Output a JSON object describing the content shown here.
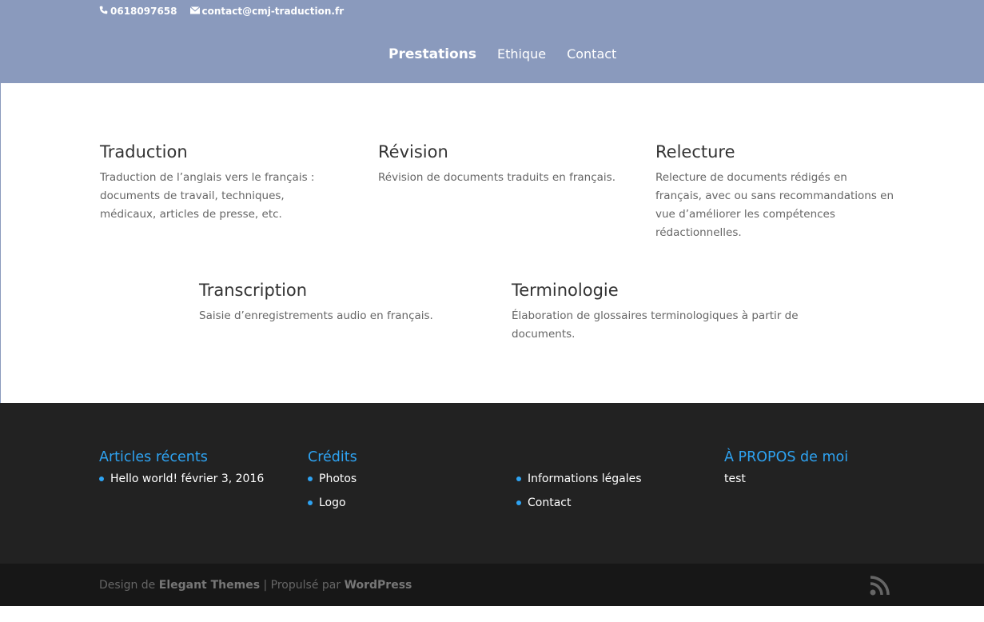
{
  "topbar": {
    "phone": "0618097658",
    "email": "contact@cmj-traduction.fr"
  },
  "nav": {
    "items": [
      "Prestations",
      "Ethique",
      "Contact"
    ]
  },
  "services": [
    {
      "title": "Traduction",
      "text": "Traduction de l’anglais vers le français : documents de travail, techniques, médicaux, articles de presse, etc."
    },
    {
      "title": "Révision",
      "text": "Révision de documents traduits en français."
    },
    {
      "title": "Relecture",
      "text": "Relecture de documents rédigés en français, avec ou sans recommandations en vue d’améliorer les compétences rédactionnelles."
    },
    {
      "title": "Transcription",
      "text": "Saisie d’enregistrements audio en français."
    },
    {
      "title": "Terminologie",
      "text": "Élaboration de glossaires terminologiques à partir de documents."
    }
  ],
  "footer": {
    "recent": {
      "title": "Articles récents",
      "items": [
        "Hello world! février 3, 2016"
      ]
    },
    "credits": {
      "title": "Crédits",
      "items": [
        "Photos",
        "Logo"
      ]
    },
    "legal": {
      "items": [
        "Informations légales",
        "Contact"
      ]
    },
    "about": {
      "title": "À PROPOS de moi",
      "text": "test"
    }
  },
  "bottom": {
    "design_prefix": "Design de ",
    "design_link": "Elegant Themes",
    "separator": " | Propulsé par ",
    "powered_link": "WordPress"
  },
  "colors": {
    "header_bg": "#8a9abd",
    "accent": "#2ea3f2",
    "footer_bg": "#222222"
  },
  "icons": [
    "phone-icon",
    "email-icon",
    "rss-icon"
  ]
}
